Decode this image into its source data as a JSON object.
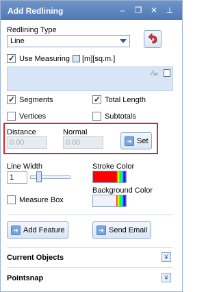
{
  "window": {
    "title": "Add Redlining",
    "controls": [
      "minimize",
      "restore",
      "close",
      "pin"
    ]
  },
  "redlining_type": {
    "label": "Redlining Type",
    "selected": "Line"
  },
  "use_measuring": {
    "label": "Use Measuring",
    "checked": true,
    "units_text": "[m][sq.m.]"
  },
  "options": {
    "segments": {
      "label": "Segments",
      "checked": true
    },
    "total_length": {
      "label": "Total Length",
      "checked": true
    },
    "vertices": {
      "label": "Vertices",
      "checked": false
    },
    "subtotals": {
      "label": "Subtotals",
      "checked": false
    }
  },
  "distance": {
    "label": "Distance",
    "placeholder": "0.00"
  },
  "normal": {
    "label": "Normal",
    "placeholder": "0.00"
  },
  "set_button": {
    "label": "Set"
  },
  "line_width": {
    "label": "Line Width",
    "value": "1"
  },
  "stroke_color": {
    "label": "Stroke Color",
    "color": "#ff0000"
  },
  "background_color": {
    "label": "Background Color",
    "color": "#eef3fb"
  },
  "measure_box": {
    "label": "Measure Box",
    "checked": false
  },
  "buttons": {
    "add_feature": "Add Feature",
    "send_email": "Send Email"
  },
  "sections": {
    "current_objects": "Current Objects",
    "pointsnap": "Pointsnap"
  },
  "colors": {
    "titlebar": "#5b84bf",
    "highlight": "#e0202a"
  }
}
